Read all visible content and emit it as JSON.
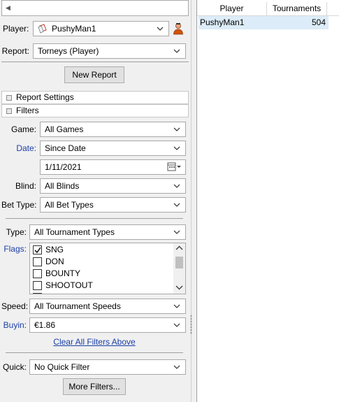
{
  "top_bar": {
    "value": ""
  },
  "player": {
    "label": "Player:",
    "value": "PushyMan1"
  },
  "report": {
    "label": "Report:",
    "value": "Torneys (Player)"
  },
  "new_report_label": "New Report",
  "sections": {
    "report_settings": "Report Settings",
    "filters": "Filters"
  },
  "filters": {
    "game": {
      "label": "Game:",
      "value": "All Games"
    },
    "date": {
      "label": "Date:",
      "value": "Since Date",
      "date_value": "1/11/2021"
    },
    "blind": {
      "label": "Blind:",
      "value": "All Blinds"
    },
    "bet_type": {
      "label": "Bet Type:",
      "value": "All Bet Types"
    },
    "type": {
      "label": "Type:",
      "value": "All Tournament Types"
    },
    "flags": {
      "label": "Flags:",
      "items": [
        {
          "label": "SNG",
          "checked": true
        },
        {
          "label": "DON",
          "checked": false
        },
        {
          "label": "BOUNTY",
          "checked": false
        },
        {
          "label": "SHOOTOUT",
          "checked": false
        }
      ]
    },
    "speed": {
      "label": "Speed:",
      "value": "All Tournament Speeds"
    },
    "buyin": {
      "label": "Buyin:",
      "value": "€1.86"
    },
    "clear_link": "Clear All Filters Above",
    "quick": {
      "label": "Quick:",
      "value": "No Quick Filter"
    },
    "more_filters_label": "More Filters..."
  },
  "results": {
    "columns": [
      "Player",
      "Tournaments"
    ],
    "rows": [
      {
        "player": "PushyMan1",
        "tournaments": "504"
      }
    ]
  },
  "colors": {
    "link_blue": "#1b3ea8",
    "row_highlight": "#dcecf8",
    "panel_bg": "#f0f0f0"
  }
}
